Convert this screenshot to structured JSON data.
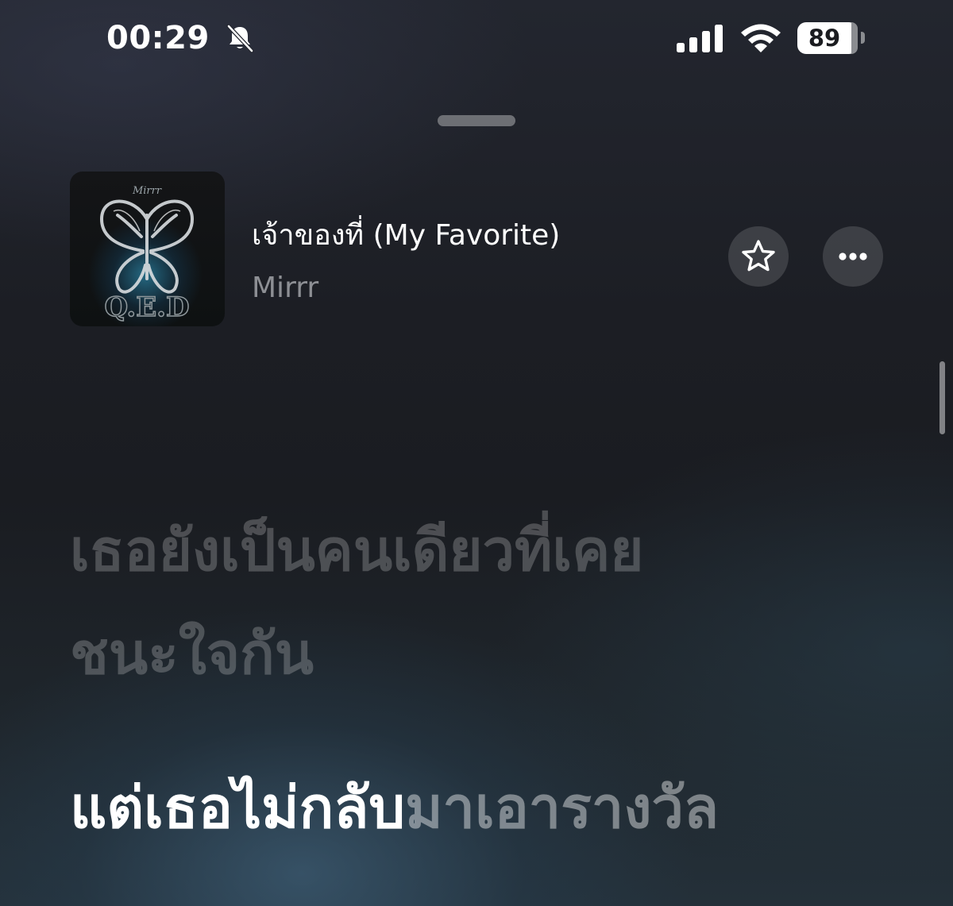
{
  "status_bar": {
    "time": "00:29",
    "battery": "89",
    "icons": [
      "bell-slash-icon",
      "cellular-signal-icon",
      "wifi-icon",
      "battery-icon"
    ]
  },
  "now_playing": {
    "title": "เจ้าของที่ (My Favorite)",
    "artist": "Mirrr",
    "album_art_text": "Q.E.D",
    "album_art_brand": "Mirrr",
    "favorite_icon": "star-icon",
    "more_icon": "ellipsis-icon"
  },
  "lyrics": {
    "line_1": "เธอยังเป็นคนเดียวที่เคย",
    "line_2": "ชนะใจกัน",
    "current_line_sung": "แต่เธอไม่กลับ",
    "current_line_unsung": "มาเอารางวัล"
  },
  "colors": {
    "text_primary": "#ffffff",
    "text_secondary": "#8d8f94",
    "button_bg": "rgba(255,255,255,0.14)"
  }
}
